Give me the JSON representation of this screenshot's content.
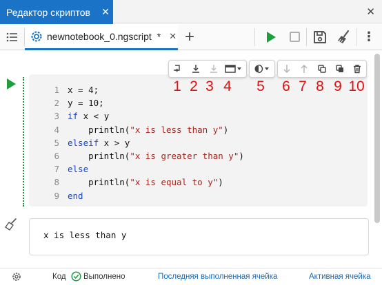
{
  "window": {
    "tab_title": "Редактор скриптов",
    "tab_close": "✕",
    "close": "✕"
  },
  "toolbar": {
    "file_tab": {
      "name": "newnotebook_0.ngscript",
      "modified": "*",
      "close": "✕"
    },
    "add": "+",
    "more": "⋮"
  },
  "code_lines": [
    {
      "n": "1",
      "parts": [
        {
          "t": "x = 4;",
          "c": "plain"
        }
      ]
    },
    {
      "n": "2",
      "parts": [
        {
          "t": "y = 10;",
          "c": "plain"
        }
      ]
    },
    {
      "n": "3",
      "parts": [
        {
          "t": "if",
          "c": "kw"
        },
        {
          "t": " x < y",
          "c": "plain"
        }
      ]
    },
    {
      "n": "4",
      "parts": [
        {
          "t": "    println(",
          "c": "plain"
        },
        {
          "t": "\"x is less than y\"",
          "c": "str"
        },
        {
          "t": ")",
          "c": "plain"
        }
      ]
    },
    {
      "n": "5",
      "parts": [
        {
          "t": "elseif",
          "c": "kw"
        },
        {
          "t": " x > y",
          "c": "plain"
        }
      ]
    },
    {
      "n": "6",
      "parts": [
        {
          "t": "    println(",
          "c": "plain"
        },
        {
          "t": "\"x is greater than y\"",
          "c": "str"
        },
        {
          "t": ")",
          "c": "plain"
        }
      ]
    },
    {
      "n": "7",
      "parts": [
        {
          "t": "else",
          "c": "kw"
        }
      ]
    },
    {
      "n": "8",
      "parts": [
        {
          "t": "    println(",
          "c": "plain"
        },
        {
          "t": "\"x is equal to y\"",
          "c": "str"
        },
        {
          "t": ")",
          "c": "plain"
        }
      ]
    },
    {
      "n": "9",
      "parts": [
        {
          "t": "end",
          "c": "kw"
        }
      ]
    }
  ],
  "callouts": [
    "1",
    "2",
    "3",
    "4",
    "5",
    "6",
    "7",
    "8",
    "9",
    "10"
  ],
  "output": {
    "text": "x is less than y"
  },
  "status": {
    "mode": "Код",
    "state": "Выполнено",
    "last_cell_link": "Последняя выполненная ячейка",
    "active_cell_link": "Активная ячейка"
  },
  "colors": {
    "accent": "#1a73c7",
    "run": "#1e9e3e",
    "callout": "#e01010",
    "keyword": "#1a46c8",
    "string": "#a1261d"
  }
}
